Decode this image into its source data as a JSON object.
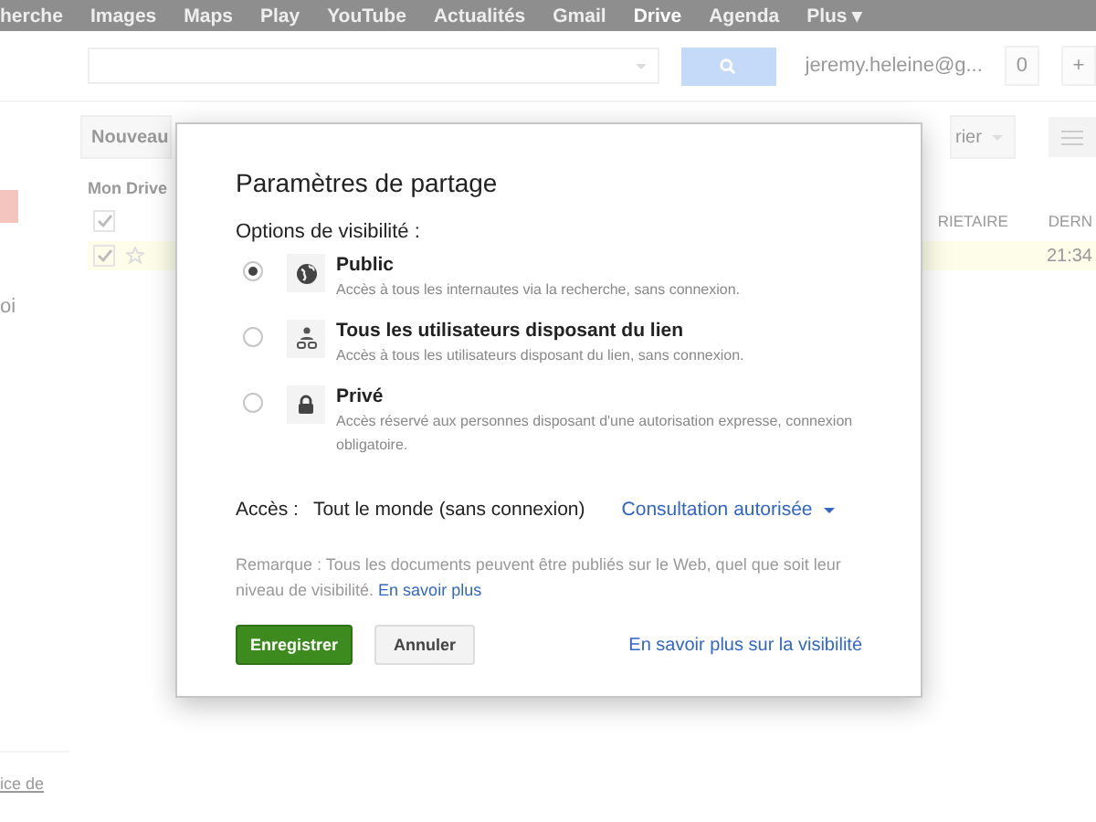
{
  "topbar": {
    "links": [
      {
        "label": "herche",
        "selected": false
      },
      {
        "label": "Images",
        "selected": false
      },
      {
        "label": "Maps",
        "selected": false
      },
      {
        "label": "Play",
        "selected": false
      },
      {
        "label": "YouTube",
        "selected": false
      },
      {
        "label": "Actualités",
        "selected": false
      },
      {
        "label": "Gmail",
        "selected": false
      },
      {
        "label": "Drive",
        "selected": true
      },
      {
        "label": "Agenda",
        "selected": false
      },
      {
        "label": "Plus ▾",
        "selected": false
      }
    ]
  },
  "header": {
    "account": "jeremy.heleine@g...",
    "notifications": "0",
    "share_button": "+"
  },
  "toolbar": {
    "new_folder": "Nouveau",
    "sort": "rier"
  },
  "sidebar": {
    "item": "oi",
    "footer_link": "ice de"
  },
  "file_list": {
    "breadcrumb": "Mon Drive",
    "all_selected": true,
    "columns": [
      {
        "label": "RIETAIRE"
      },
      {
        "label": "DERN"
      }
    ],
    "rows": [
      {
        "modified": "21:34",
        "selected": true
      }
    ]
  },
  "dialog": {
    "title": "Paramètres de partage",
    "options_label": "Options de visibilité :",
    "options": [
      {
        "kind": "globe",
        "title": "Public",
        "description": "Accès à tous les internautes via la recherche, sans connexion.",
        "selected": true
      },
      {
        "kind": "link",
        "title": "Tous les utilisateurs disposant du lien",
        "description": "Accès à tous les utilisateurs disposant du lien, sans connexion.",
        "selected": false
      },
      {
        "kind": "lock",
        "title": "Privé",
        "description": "Accès réservé aux personnes disposant d'une autorisation expresse, connexion obligatoire.",
        "selected": false
      }
    ],
    "access_label": "Accès :",
    "access_value": "Tout le monde (sans connexion)",
    "access_dropdown": "Consultation autorisée",
    "note": "Remarque : Tous les documents peuvent être publiés sur le Web, quel que soit leur niveau de visibilité.",
    "note_link": "En savoir plus",
    "save_button": "Enregistrer",
    "cancel_button": "Annuler",
    "help_link": "En savoir plus sur la visibilité"
  }
}
